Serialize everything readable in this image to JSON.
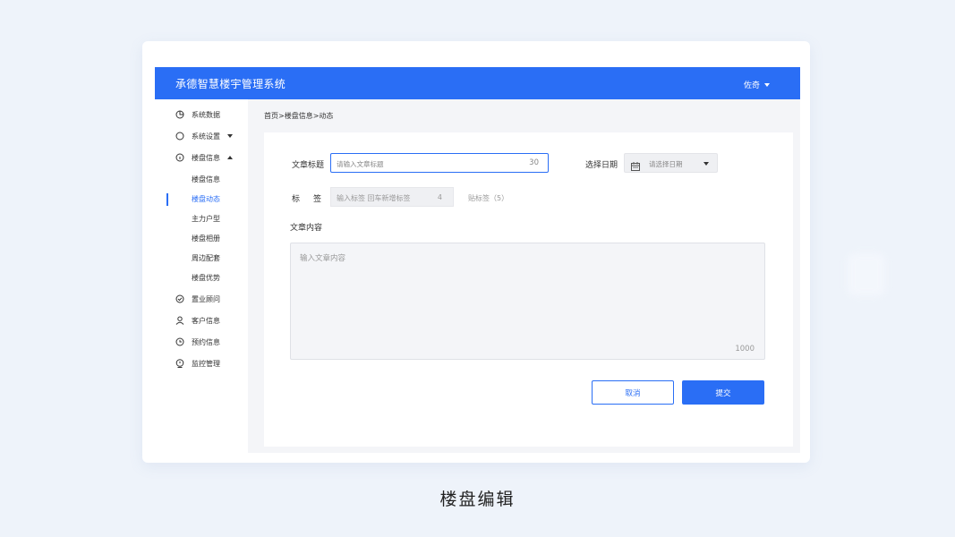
{
  "header": {
    "app_title": "承德智慧楼宇管理系统",
    "user_name": "佐奇"
  },
  "sidebar": {
    "items": [
      {
        "label": "系统数据",
        "icon": "pie-chart-icon"
      },
      {
        "label": "系统设置",
        "icon": "circle-icon",
        "expand": "collapsed"
      },
      {
        "label": "楼盘信息",
        "icon": "info-circle-icon",
        "expand": "expanded"
      },
      {
        "label": "置业顾问",
        "icon": "check-circle-icon"
      },
      {
        "label": "客户信息",
        "icon": "user-icon"
      },
      {
        "label": "预约信息",
        "icon": "clock-icon"
      },
      {
        "label": "监控管理",
        "icon": "monitor-icon"
      }
    ],
    "sub_items": [
      "楼盘信息",
      "楼盘动态",
      "主力户型",
      "楼盘相册",
      "周边配套",
      "楼盘优势"
    ],
    "active_sub": "楼盘动态"
  },
  "breadcrumb": "首页>楼盘信息>动态",
  "form": {
    "title_label": "文章标题",
    "title_placeholder": "请输入文章标题",
    "title_counter": "30",
    "date_label": "选择日期",
    "date_placeholder": "请选择日期",
    "tag_label_1": "标",
    "tag_label_2": "签",
    "tag_placeholder": "输入标签 回车新增标签",
    "tag_counter": "4",
    "tag_hint": "贴标签（5）",
    "content_label": "文章内容",
    "content_placeholder": "输入文章内容",
    "content_counter": "1000",
    "cancel_label": "取消",
    "submit_label": "提交"
  },
  "caption": "楼盘编辑",
  "colors": {
    "primary": "#2a6ef5",
    "background": "#eef3fa"
  }
}
